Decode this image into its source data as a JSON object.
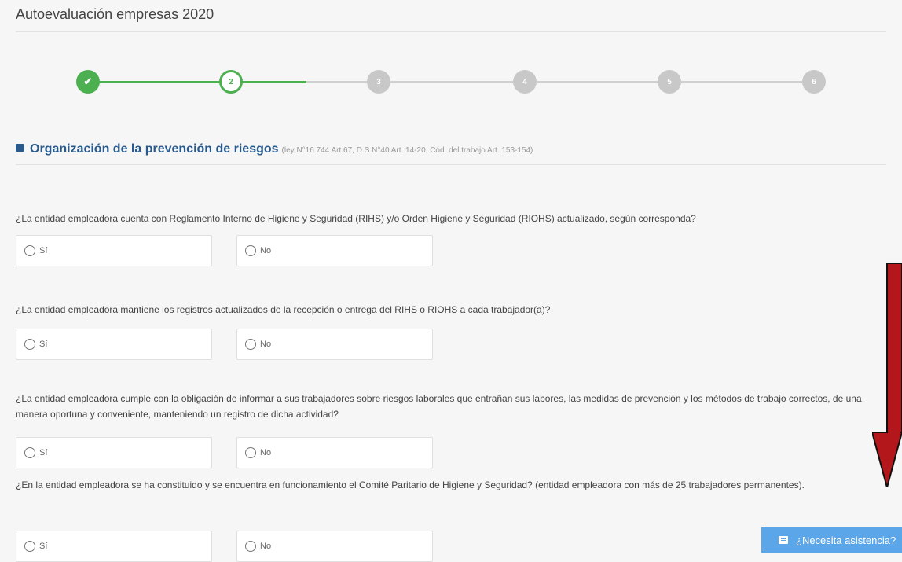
{
  "page": {
    "title": "Autoevaluación empresas 2020"
  },
  "stepper": {
    "steps": [
      {
        "label": "✔",
        "state": "done"
      },
      {
        "label": "2",
        "state": "active"
      },
      {
        "label": "3",
        "state": "pending"
      },
      {
        "label": "4",
        "state": "pending"
      },
      {
        "label": "5",
        "state": "pending"
      },
      {
        "label": "6",
        "state": "pending"
      }
    ],
    "done_color": "#4caf50",
    "pending_color": "#c8c8c8"
  },
  "section": {
    "icon": "briefcase-icon",
    "title": "Organización de la prevención de riesgos",
    "law": "(ley N°16.744 Art.67, D.S N°40 Art. 14-20, Cód. del trabajo Art. 153-154)"
  },
  "questions": [
    {
      "text": "¿La entidad empleadora cuenta con Reglamento Interno de Higiene y Seguridad (RIHS) y/o Orden Higiene y Seguridad (RIOHS) actualizado, según corresponda?",
      "yes": "Sí",
      "no": "No"
    },
    {
      "text": "¿La entidad empleadora mantiene los registros actualizados de la recepción o entrega del RIHS o RIOHS a cada trabajador(a)?",
      "yes": "Sí",
      "no": "No"
    },
    {
      "text": "¿La entidad empleadora cumple con la obligación de informar a sus trabajadores sobre riesgos laborales que entrañan sus labores, las medidas de prevención y los métodos de trabajo correctos, de una manera oportuna y conveniente, manteniendo un registro de dicha actividad?",
      "yes": "Sí",
      "no": "No"
    },
    {
      "text": "¿En la entidad empleadora se ha constituido y se encuentra en funcionamiento el Comité Paritario de Higiene y Seguridad? (entidad empleadora con más de 25 trabajadores permanentes).",
      "yes": "Sí",
      "no": "No"
    }
  ],
  "assist": {
    "label": "¿Necesita asistencia?",
    "icon": "chat-icon",
    "color": "#5aa6e8"
  },
  "annotation": {
    "icon": "red-down-arrow-icon",
    "color": "#b3171b"
  }
}
